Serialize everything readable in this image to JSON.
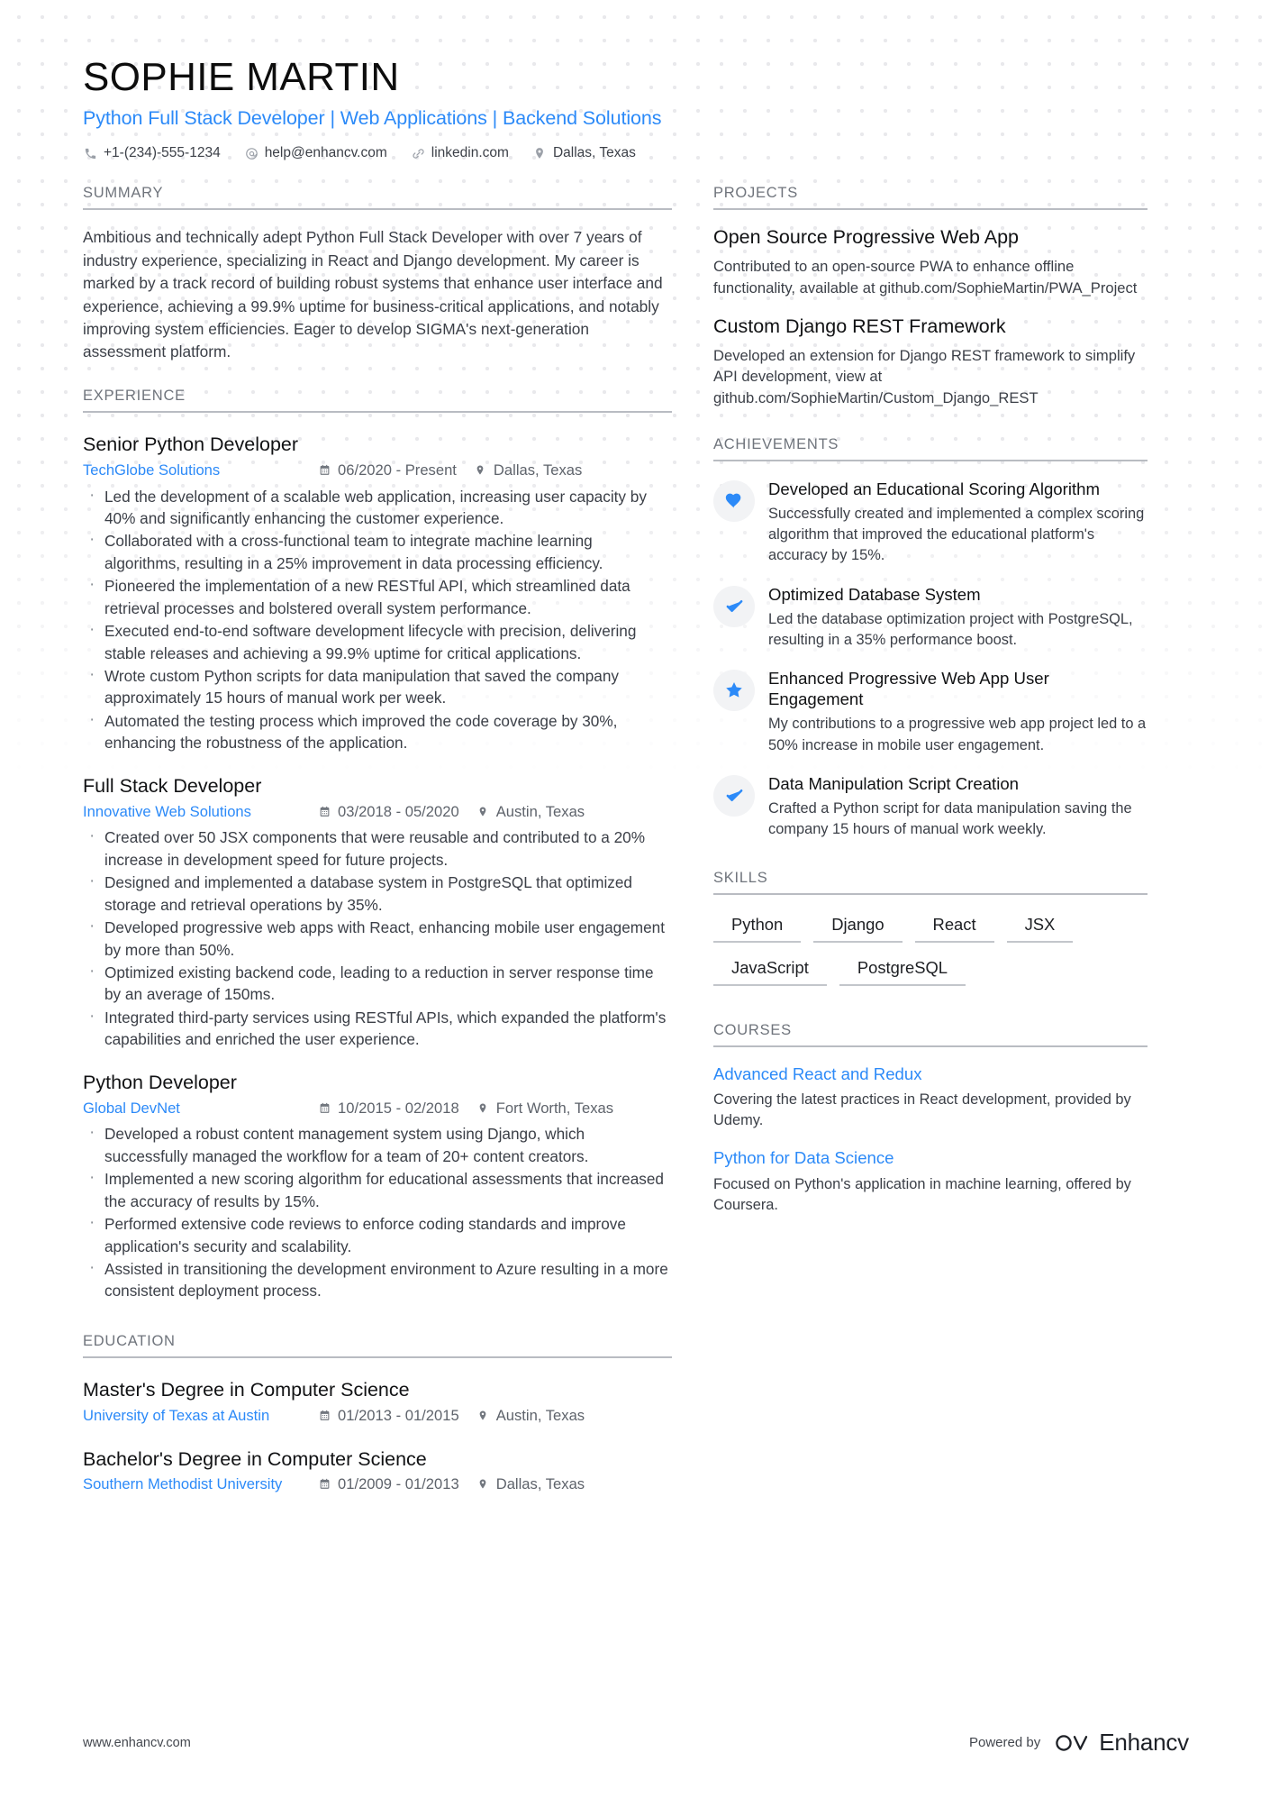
{
  "header": {
    "name": "SOPHIE MARTIN",
    "tagline": "Python Full Stack Developer | Web Applications | Backend Solutions",
    "contacts": [
      {
        "icon": "phone-icon",
        "text": "+1-(234)-555-1234"
      },
      {
        "icon": "email-icon",
        "text": "help@enhancv.com"
      },
      {
        "icon": "link-icon",
        "text": "linkedin.com"
      },
      {
        "icon": "location-icon",
        "text": "Dallas, Texas"
      }
    ]
  },
  "accent_color": "#2c8af8",
  "sections": {
    "summary_heading": "SUMMARY",
    "experience_heading": "EXPERIENCE",
    "education_heading": "EDUCATION",
    "projects_heading": "PROJECTS",
    "achievements_heading": "ACHIEVEMENTS",
    "skills_heading": "SKILLS",
    "courses_heading": "COURSES"
  },
  "summary": {
    "text": "Ambitious and technically adept Python Full Stack Developer with over 7 years of industry experience, specializing in React and Django development. My career is marked by a track record of building robust systems that enhance user interface and experience, achieving a 99.9% uptime for business-critical applications, and notably improving system efficiencies. Eager to develop SIGMA's next-generation assessment platform."
  },
  "experience": [
    {
      "title": "Senior Python Developer",
      "org": "TechGlobe Solutions",
      "dates": "06/2020 - Present",
      "location": "Dallas, Texas",
      "bullets": [
        "Led the development of a scalable web application, increasing user capacity by 40% and significantly enhancing the customer experience.",
        "Collaborated with a cross-functional team to integrate machine learning algorithms, resulting in a 25% improvement in data processing efficiency.",
        "Pioneered the implementation of a new RESTful API, which streamlined data retrieval processes and bolstered overall system performance.",
        "Executed end-to-end software development lifecycle with precision, delivering stable releases and achieving a 99.9% uptime for critical applications.",
        "Wrote custom Python scripts for data manipulation that saved the company approximately 15 hours of manual work per week.",
        "Automated the testing process which improved the code coverage by 30%, enhancing the robustness of the application."
      ]
    },
    {
      "title": "Full Stack Developer",
      "org": "Innovative Web Solutions",
      "dates": "03/2018 - 05/2020",
      "location": "Austin, Texas",
      "bullets": [
        "Created over 50 JSX components that were reusable and contributed to a 20% increase in development speed for future projects.",
        "Designed and implemented a database system in PostgreSQL that optimized storage and retrieval operations by 35%.",
        "Developed progressive web apps with React, enhancing mobile user engagement by more than 50%.",
        "Optimized existing backend code, leading to a reduction in server response time by an average of 150ms.",
        "Integrated third-party services using RESTful APIs, which expanded the platform's capabilities and enriched the user experience."
      ]
    },
    {
      "title": "Python Developer",
      "org": "Global DevNet",
      "dates": "10/2015 - 02/2018",
      "location": "Fort Worth, Texas",
      "bullets": [
        "Developed a robust content management system using Django, which successfully managed the workflow for a team of 20+ content creators.",
        "Implemented a new scoring algorithm for educational assessments that increased the accuracy of results by 15%.",
        "Performed extensive code reviews to enforce coding standards and improve application's security and scalability.",
        "Assisted in transitioning the development environment to Azure resulting in a more consistent deployment process."
      ]
    }
  ],
  "education": [
    {
      "title": "Master's Degree in Computer Science",
      "org": "University of Texas at Austin",
      "dates": "01/2013 - 01/2015",
      "location": "Austin, Texas"
    },
    {
      "title": "Bachelor's Degree in Computer Science",
      "org": "Southern Methodist University",
      "dates": "01/2009 - 01/2013",
      "location": "Dallas, Texas"
    }
  ],
  "projects": [
    {
      "title": "Open Source Progressive Web App",
      "desc": "Contributed to an open-source PWA to enhance offline functionality, available at github.com/SophieMartin/PWA_Project"
    },
    {
      "title": "Custom Django REST Framework",
      "desc": "Developed an extension for Django REST framework to simplify API development, view at github.com/SophieMartin/Custom_Django_REST"
    }
  ],
  "achievements": [
    {
      "icon": "heart-icon",
      "title": "Developed an Educational Scoring Algorithm",
      "desc": "Successfully created and implemented a complex scoring algorithm that improved the educational platform's accuracy by 15%."
    },
    {
      "icon": "check-icon",
      "title": "Optimized Database System",
      "desc": "Led the database optimization project with PostgreSQL, resulting in a 35% performance boost."
    },
    {
      "icon": "star-icon",
      "title": "Enhanced Progressive Web App User Engagement",
      "desc": "My contributions to a progressive web app project led to a 50% increase in mobile user engagement."
    },
    {
      "icon": "check-icon",
      "title": "Data Manipulation Script Creation",
      "desc": "Crafted a Python script for data manipulation saving the company 15 hours of manual work weekly."
    }
  ],
  "skills": [
    "Python",
    "Django",
    "React",
    "JSX",
    "JavaScript",
    "PostgreSQL"
  ],
  "courses": [
    {
      "title": "Advanced React and Redux",
      "desc": "Covering the latest practices in React development, provided by Udemy."
    },
    {
      "title": "Python for Data Science",
      "desc": "Focused on Python's application in machine learning, offered by Coursera."
    }
  ],
  "footer": {
    "url": "www.enhancv.com",
    "powered_by": "Powered by",
    "brand": "Enhancv"
  }
}
